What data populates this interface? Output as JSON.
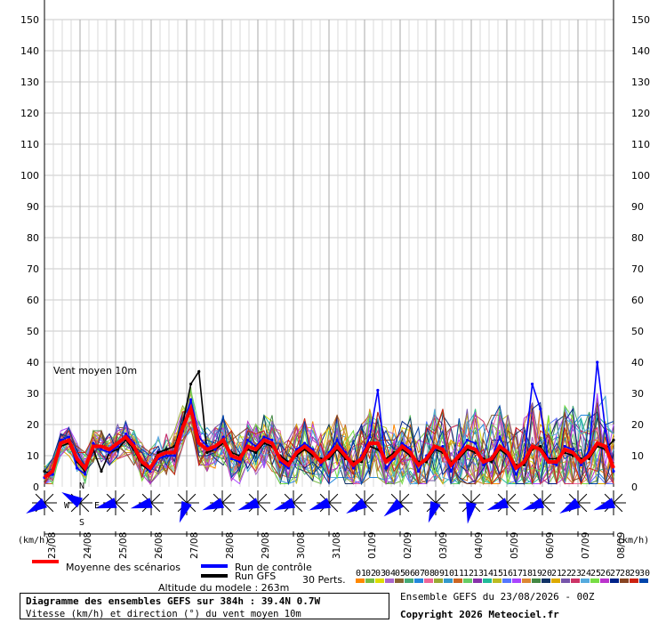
{
  "chart_data": {
    "type": "line",
    "title": "Vent moyen 10m",
    "unit_left": "(km/h)",
    "unit_right": "(km/h)",
    "ylim": [
      0,
      150
    ],
    "yticks": [
      0,
      10,
      20,
      30,
      40,
      50,
      60,
      70,
      80,
      90,
      100,
      110,
      120,
      130,
      140,
      150
    ],
    "grid": true,
    "x_dates": [
      "23/08",
      "24/08",
      "25/08",
      "26/08",
      "27/08",
      "28/08",
      "29/08",
      "30/08",
      "31/08",
      "01/09",
      "02/09",
      "03/09",
      "04/09",
      "05/09",
      "06/09",
      "07/09",
      "08/09"
    ],
    "series": [
      {
        "name": "Moyenne des scénarios",
        "color": "#ff0000",
        "values": [
          3,
          5,
          14,
          15,
          9,
          6,
          13,
          13,
          12,
          14,
          16,
          13,
          8,
          6,
          10,
          11,
          11,
          19,
          25,
          14,
          12,
          13,
          15,
          10,
          9,
          13,
          12,
          15,
          14,
          9,
          7,
          11,
          13,
          11,
          8,
          10,
          13,
          10,
          7,
          9,
          14,
          14,
          8,
          10,
          13,
          11,
          7,
          9,
          13,
          12,
          7,
          10,
          13,
          12,
          8,
          9,
          13,
          11,
          6,
          8,
          13,
          12,
          8,
          8,
          12,
          11,
          8,
          10,
          14,
          13,
          6
        ]
      },
      {
        "name": "Run de contrôle",
        "color": "#0000ff",
        "values": [
          3,
          4,
          15,
          16,
          6,
          4,
          14,
          12,
          11,
          13,
          17,
          14,
          8,
          5,
          9,
          10,
          10,
          18,
          28,
          16,
          13,
          12,
          16,
          9,
          8,
          15,
          13,
          16,
          15,
          8,
          6,
          12,
          14,
          12,
          7,
          11,
          15,
          11,
          6,
          10,
          16,
          31,
          6,
          9,
          14,
          12,
          5,
          10,
          12,
          13,
          5,
          11,
          15,
          14,
          7,
          9,
          16,
          10,
          4,
          9,
          33,
          25,
          8,
          7,
          13,
          12,
          7,
          12,
          40,
          18,
          5
        ]
      },
      {
        "name": "Run GFS",
        "color": "#000000",
        "values": [
          5,
          4,
          13,
          14,
          8,
          5,
          12,
          5,
          11,
          12,
          15,
          12,
          7,
          5,
          11,
          12,
          13,
          20,
          33,
          37,
          11,
          12,
          14,
          11,
          10,
          12,
          11,
          14,
          13,
          10,
          8,
          10,
          12,
          10,
          9,
          9,
          12,
          9,
          8,
          8,
          13,
          12,
          9,
          11,
          12,
          10,
          8,
          8,
          12,
          11,
          8,
          9,
          12,
          11,
          9,
          8,
          12,
          10,
          7,
          7,
          12,
          13,
          9,
          9,
          11,
          10,
          9,
          9,
          13,
          12,
          15
        ]
      }
    ],
    "perturbations_label": "30 Perts.",
    "perturbation_ids": [
      "01",
      "02",
      "03",
      "04",
      "05",
      "06",
      "07",
      "08",
      "09",
      "10",
      "11",
      "12",
      "13",
      "14",
      "15",
      "16",
      "17",
      "18",
      "19",
      "20",
      "21",
      "22",
      "23",
      "24",
      "25",
      "26",
      "27",
      "28",
      "29",
      "30"
    ],
    "perturbation_colors": [
      "#ff8800",
      "#77bb44",
      "#dddd00",
      "#aa66cc",
      "#886633",
      "#44aa77",
      "#2288dd",
      "#ee6699",
      "#99aa33",
      "#3399cc",
      "#cc6622",
      "#66cc66",
      "#8833aa",
      "#22bb99",
      "#bbbb22",
      "#5577ff",
      "#aa44ff",
      "#dd8833",
      "#448844",
      "#113366",
      "#ddaa00",
      "#7755aa",
      "#cc3366",
      "#55aadd",
      "#77dd44",
      "#bb33cc",
      "#002288",
      "#884422",
      "#cc2211",
      "#0044aa"
    ],
    "wind_directions_deg": [
      240,
      300,
      255,
      255,
      200,
      250,
      250,
      250,
      250,
      240,
      230,
      200,
      190,
      250,
      250,
      240,
      250,
      200,
      250,
      240,
      250,
      245,
      230,
      250,
      250,
      230,
      260,
      245,
      240
    ]
  },
  "labels": {
    "compass_n": "N",
    "compass_e": "E",
    "compass_w": "W",
    "compass_s": "S",
    "altitude": "Altitude du modele : 263m",
    "box_title": "Diagramme des ensembles GEFS sur 384h : 39.4N 0.7W",
    "box_subtitle": "Vitesse (km/h) et direction (°) du vent moyen 10m",
    "ensemble_date": "Ensemble GEFS du 23/08/2026 - 00Z",
    "copyright": "Copyright 2026 Meteociel.fr"
  }
}
